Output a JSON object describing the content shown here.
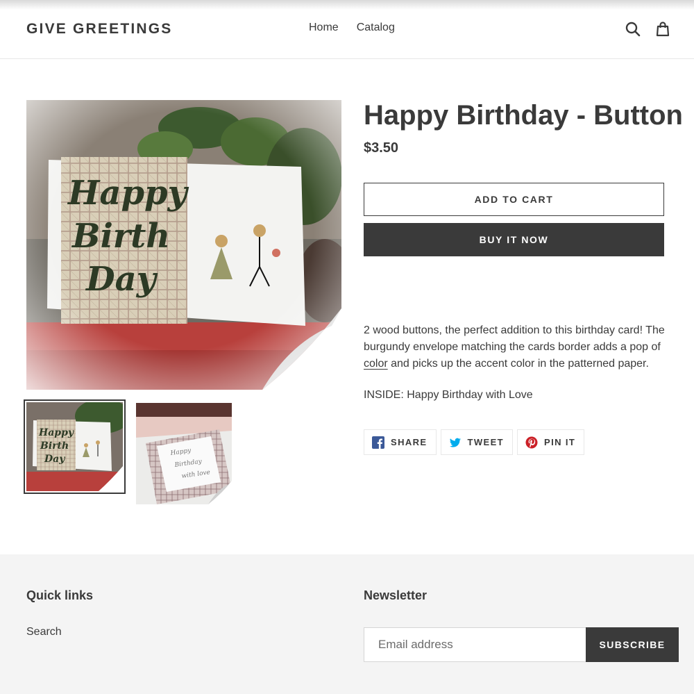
{
  "header": {
    "logo": "GIVE GREETINGS",
    "nav": [
      {
        "label": "Home"
      },
      {
        "label": "Catalog"
      }
    ],
    "icons": [
      "search-icon",
      "cart-icon"
    ]
  },
  "product": {
    "title": "Happy Birthday - Button",
    "price": "$3.50",
    "add_to_cart": "ADD TO CART",
    "buy_now": "BUY IT NOW",
    "description": {
      "p1_a": "2 wood buttons,  the perfect addition to this birthday card! The burgundy envelope matching the cards border adds a pop of ",
      "p1_link": "color",
      "p1_b": " and picks up the accent color in the patterned paper.",
      "p2": "INSIDE: Happy Birthday with Love"
    },
    "images": {
      "card_text_lines": [
        "Happy",
        "Birth",
        "Day"
      ],
      "thumb2_lines": [
        "Happy",
        "Birthday",
        "with love"
      ]
    },
    "share": [
      {
        "label": "SHARE",
        "icon": "facebook-icon",
        "color": "#3b5998"
      },
      {
        "label": "TWEET",
        "icon": "twitter-icon",
        "color": "#00aced"
      },
      {
        "label": "PIN IT",
        "icon": "pinterest-icon",
        "color": "#cb2027"
      }
    ]
  },
  "footer": {
    "quick_links_title": "Quick links",
    "quick_links": [
      {
        "label": "Search"
      }
    ],
    "newsletter_title": "Newsletter",
    "email_placeholder": "Email address",
    "subscribe": "SUBSCRIBE"
  },
  "colors": {
    "text": "#3a3a3a",
    "button_dark": "#3a3a3a",
    "footer_bg": "#f4f4f4",
    "envelope": "#b8403c"
  }
}
